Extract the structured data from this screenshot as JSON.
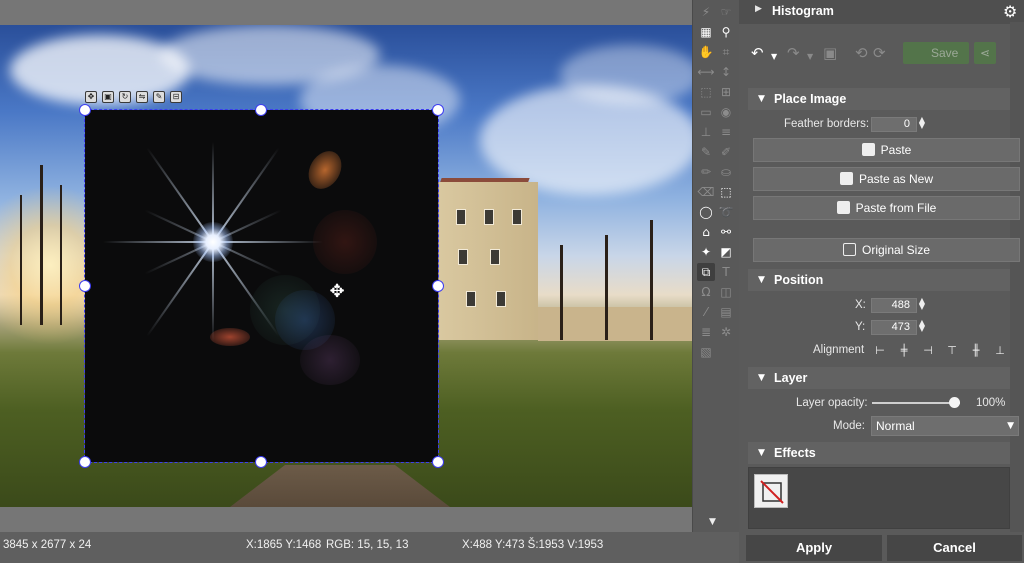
{
  "canvas": {
    "move_cursor_glyph": "✥"
  },
  "statusbar": {
    "image_info": "3845 x 2677 x 24",
    "cursor_info": "X:1865 Y:1468",
    "rgb_info": "RGB: 15, 15, 13",
    "layer_info": "X:488  Y:473  Š:1953  V:1953"
  },
  "panel": {
    "histogram_label": "Histogram",
    "settings_icon": "gear-icon",
    "toolbar": {
      "undo_icon": "undo-icon",
      "redo_icon": "redo-icon",
      "save_label": "Save"
    },
    "place_image": {
      "title": "Place Image",
      "feather_label": "Feather borders:",
      "feather_value": "0",
      "paste_label": "Paste",
      "paste_as_new_label": "Paste as New",
      "paste_from_file_label": "Paste from File",
      "original_size_label": "Original Size"
    },
    "position": {
      "title": "Position",
      "x_label": "X:",
      "x_value": "488",
      "y_label": "Y:",
      "y_value": "473",
      "alignment_label": "Alignment"
    },
    "layer": {
      "title": "Layer",
      "opacity_label": "Layer opacity:",
      "opacity_value": "100%",
      "opacity_fraction": 1.0,
      "mode_label": "Mode:",
      "mode_value": "Normal"
    },
    "effects": {
      "title": "Effects"
    },
    "apply_label": "Apply",
    "cancel_label": "Cancel"
  },
  "colors": {
    "selection_outline": "#3d3df0",
    "panel_bg": "#5a5a5a",
    "save_green": "#4f8a3e"
  }
}
